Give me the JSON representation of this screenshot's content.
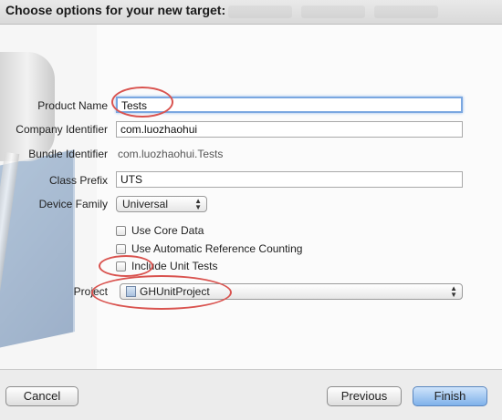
{
  "dialog": {
    "title": "Choose options for your new target:"
  },
  "form": {
    "product_name": {
      "label": "Product Name",
      "value": "Tests"
    },
    "company_identifier": {
      "label": "Company Identifier",
      "value": "com.luozhaohui"
    },
    "bundle_identifier": {
      "label": "Bundle Identifier",
      "value": "com.luozhaohui.Tests"
    },
    "class_prefix": {
      "label": "Class Prefix",
      "value": "UTS"
    },
    "device_family": {
      "label": "Device Family",
      "value": "Universal"
    },
    "checkboxes": [
      {
        "label": "Use Core Data",
        "checked": false
      },
      {
        "label": "Use Automatic Reference Counting",
        "checked": false
      },
      {
        "label": "Include Unit Tests",
        "checked": false
      }
    ],
    "project": {
      "label": "Project",
      "value": "GHUnitProject"
    }
  },
  "buttons": {
    "cancel": "Cancel",
    "previous": "Previous",
    "finish": "Finish"
  },
  "colors": {
    "annotation_ring": "#d9534f",
    "focus_ring": "#7aa7e0",
    "primary_button": "#7fb1ea"
  }
}
